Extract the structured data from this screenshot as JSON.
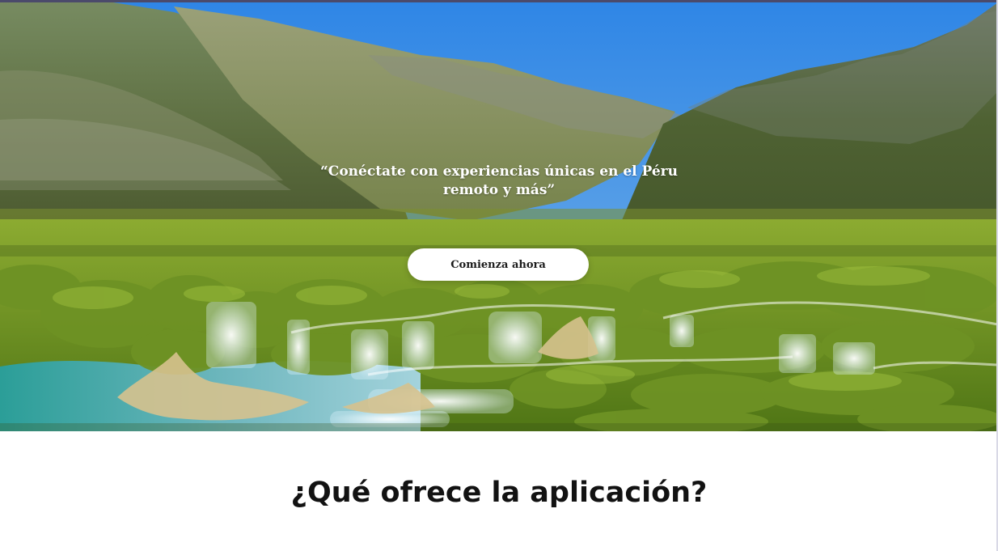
{
  "hero": {
    "quote": "“Conéctate con experiencias únicas en el Péru remoto y más”",
    "cta_label": "Comienza ahora"
  },
  "section": {
    "title": "¿Qué ofrece la aplicación?"
  },
  "colors": {
    "sky": "#5aa2df",
    "mountain_green": "#5f7341",
    "moss_green": "#6d9a22",
    "water_teal": "#2e9b93",
    "button_bg": "#ffffff",
    "text_dark": "#121212"
  }
}
